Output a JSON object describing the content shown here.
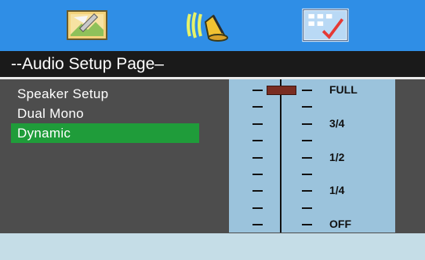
{
  "tabs": [
    {
      "name": "general-setup",
      "icon": "wrench-picture-icon"
    },
    {
      "name": "audio-setup",
      "icon": "speaker-icon"
    },
    {
      "name": "preference",
      "icon": "checklist-icon"
    }
  ],
  "page_title": "--Audio Setup Page–",
  "menu": {
    "items": [
      {
        "label": "Speaker  Setup",
        "selected": false
      },
      {
        "label": "Dual  Mono",
        "selected": false
      },
      {
        "label": "Dynamic",
        "selected": true
      }
    ]
  },
  "slider": {
    "labels": [
      "FULL",
      "3/4",
      "1/2",
      "1/4",
      "OFF"
    ],
    "value_label": "FULL",
    "value_fraction": 1.0
  },
  "colors": {
    "tab_bar": "#2f8ee6",
    "title_bar": "#1a1a1a",
    "background": "#4d4d4d",
    "selected_item": "#1f9c3a",
    "slider_panel": "#9bc3dc",
    "knob": "#7a2d22",
    "status_bar": "#c5dde7"
  }
}
